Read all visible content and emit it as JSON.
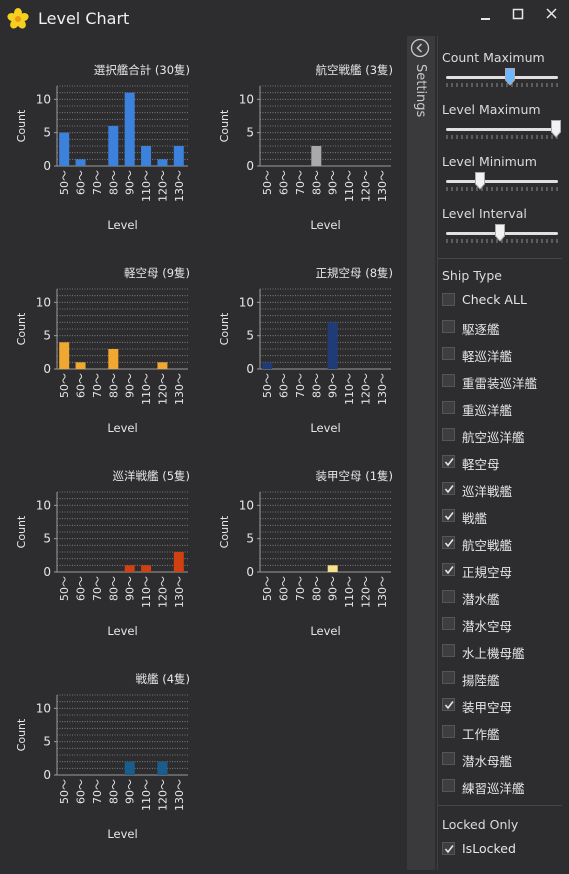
{
  "window": {
    "title": "Level Chart"
  },
  "levels": [
    "50～",
    "60～",
    "70～",
    "80～",
    "90～",
    "110～",
    "120～",
    "130～"
  ],
  "x_axis_label": "Level",
  "y_axis_label": "Count",
  "y_ticks": [
    0,
    5,
    10
  ],
  "chart_data": [
    {
      "type": "bar",
      "title": "選択艦合計 (30隻)",
      "color": "#3c82dc",
      "ylim": [
        0,
        12
      ],
      "values": [
        5,
        1,
        0,
        6,
        11,
        3,
        1,
        3
      ]
    },
    {
      "type": "bar",
      "title": "航空戦艦 (3隻)",
      "color": "#a9a9a9",
      "ylim": [
        0,
        12
      ],
      "values": [
        0,
        0,
        0,
        3,
        0,
        0,
        0,
        0
      ]
    },
    {
      "type": "bar",
      "title": "軽空母 (9隻)",
      "color": "#f0a830",
      "ylim": [
        0,
        12
      ],
      "values": [
        4,
        1,
        0,
        3,
        0,
        0,
        1,
        0
      ]
    },
    {
      "type": "bar",
      "title": "正規空母 (8隻)",
      "color": "#1f3c78",
      "ylim": [
        0,
        12
      ],
      "values": [
        1,
        0,
        0,
        0,
        7,
        0,
        0,
        0
      ]
    },
    {
      "type": "bar",
      "title": "巡洋戦艦 (5隻)",
      "color": "#d04010",
      "ylim": [
        0,
        12
      ],
      "values": [
        0,
        0,
        0,
        0,
        1,
        1,
        0,
        3
      ]
    },
    {
      "type": "bar",
      "title": "装甲空母 (1隻)",
      "color": "#f5e28a",
      "ylim": [
        0,
        12
      ],
      "values": [
        0,
        0,
        0,
        0,
        1,
        0,
        0,
        0
      ]
    },
    {
      "type": "bar",
      "title": "戦艦 (4隻)",
      "color": "#1a5d8c",
      "ylim": [
        0,
        12
      ],
      "values": [
        0,
        0,
        0,
        0,
        2,
        0,
        2,
        0
      ]
    }
  ],
  "settings": {
    "tab_label": "Settings",
    "sliders": [
      {
        "label": "Count Maximum",
        "value": 0.57
      },
      {
        "label": "Level Maximum",
        "value": 0.98
      },
      {
        "label": "Level Minimum",
        "value": 0.3
      },
      {
        "label": "Level Interval",
        "value": 0.48
      }
    ],
    "ship_type_header": "Ship Type",
    "ship_types": [
      {
        "label": "Check ALL",
        "checked": false
      },
      {
        "label": "駆逐艦",
        "checked": false
      },
      {
        "label": "軽巡洋艦",
        "checked": false
      },
      {
        "label": "重雷装巡洋艦",
        "checked": false
      },
      {
        "label": "重巡洋艦",
        "checked": false
      },
      {
        "label": "航空巡洋艦",
        "checked": false
      },
      {
        "label": "軽空母",
        "checked": true
      },
      {
        "label": "巡洋戦艦",
        "checked": true
      },
      {
        "label": "戦艦",
        "checked": true
      },
      {
        "label": "航空戦艦",
        "checked": true
      },
      {
        "label": "正規空母",
        "checked": true
      },
      {
        "label": "潜水艦",
        "checked": false
      },
      {
        "label": "潜水空母",
        "checked": false
      },
      {
        "label": "水上機母艦",
        "checked": false
      },
      {
        "label": "揚陸艦",
        "checked": false
      },
      {
        "label": "装甲空母",
        "checked": true
      },
      {
        "label": "工作艦",
        "checked": false
      },
      {
        "label": "潜水母艦",
        "checked": false
      },
      {
        "label": "練習巡洋艦",
        "checked": false
      }
    ],
    "locked_header": "Locked Only",
    "locked": {
      "label": "IsLocked",
      "checked": true
    }
  }
}
